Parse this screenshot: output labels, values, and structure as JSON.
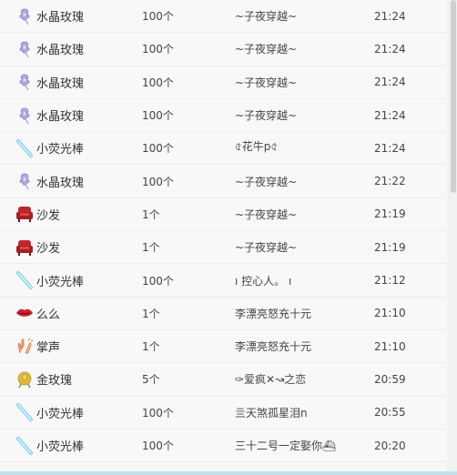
{
  "rows": [
    {
      "icon": "crystal-rose-icon",
      "gift": "水晶玫瑰",
      "qty": "100个",
      "user": "~子夜穿越~",
      "time": "21:24"
    },
    {
      "icon": "crystal-rose-icon",
      "gift": "水晶玫瑰",
      "qty": "100个",
      "user": "~子夜穿越~",
      "time": "21:24"
    },
    {
      "icon": "crystal-rose-icon",
      "gift": "水晶玫瑰",
      "qty": "100个",
      "user": "~子夜穿越~",
      "time": "21:24"
    },
    {
      "icon": "crystal-rose-icon",
      "gift": "水晶玫瑰",
      "qty": "100个",
      "user": "~子夜穿越~",
      "time": "21:24"
    },
    {
      "icon": "glow-stick-icon",
      "gift": "小荧光棒",
      "qty": "100个",
      "user": "৫花牛p৫",
      "time": "21:24"
    },
    {
      "icon": "crystal-rose-icon",
      "gift": "水晶玫瑰",
      "qty": "100个",
      "user": "~子夜穿越~",
      "time": "21:22"
    },
    {
      "icon": "sofa-icon",
      "gift": "沙发",
      "qty": "1个",
      "user": "~子夜穿越~",
      "time": "21:19"
    },
    {
      "icon": "sofa-icon",
      "gift": "沙发",
      "qty": "1个",
      "user": "~子夜穿越~",
      "time": "21:19"
    },
    {
      "icon": "glow-stick-icon",
      "gift": "小荧光棒",
      "qty": "100个",
      "user": "ı 控心人。 ı",
      "time": "21:12"
    },
    {
      "icon": "lips-icon",
      "gift": "么么",
      "qty": "1个",
      "user": "李漂亮怒充十元",
      "time": "21:10"
    },
    {
      "icon": "clapping-hands-icon",
      "gift": "掌声",
      "qty": "1个",
      "user": "李漂亮怒充十元",
      "time": "21:10"
    },
    {
      "icon": "gold-rose-icon",
      "gift": "金玫瑰",
      "qty": "5个",
      "user": "✑爱疯✕↝之恋",
      "time": "20:59"
    },
    {
      "icon": "glow-stick-icon",
      "gift": "小荧光棒",
      "qty": "100个",
      "user": "亖天煞孤星泪n",
      "time": "20:55"
    },
    {
      "icon": "glow-stick-icon",
      "gift": "小荧光棒",
      "qty": "100个",
      "user": "三十二号一定娶你⛴",
      "time": "20:20"
    }
  ],
  "colors": {
    "crystal_rose": "#b7a6e6",
    "glow_stick": "#7fd3ef",
    "sofa": "#c0262c",
    "lips": "#d21f2d",
    "clap": "#f2a36b",
    "gold_rose": "#e0b93a"
  }
}
